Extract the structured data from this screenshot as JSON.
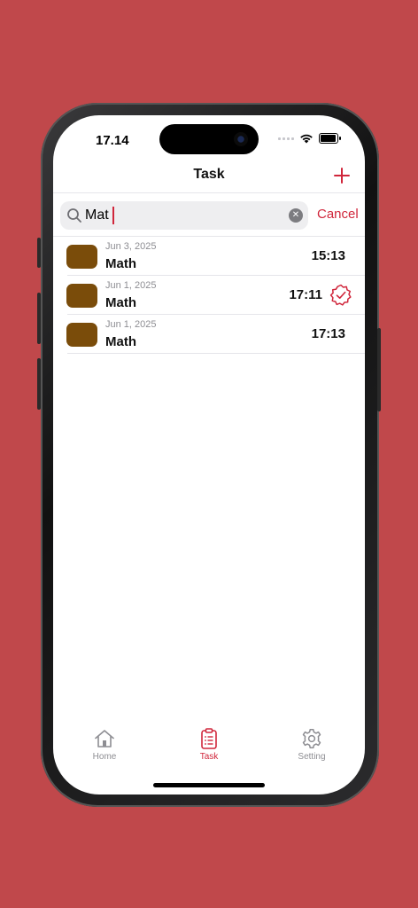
{
  "status": {
    "time": "17.14"
  },
  "nav": {
    "title": "Task"
  },
  "search": {
    "value": "Mat",
    "cancel_label": "Cancel"
  },
  "tasks": [
    {
      "date": "Jun 3, 2025",
      "name": "Math",
      "time": "15:13",
      "completed": false
    },
    {
      "date": "Jun 1, 2025",
      "name": "Math",
      "time": "17:11",
      "completed": true
    },
    {
      "date": "Jun 1, 2025",
      "name": "Math",
      "time": "17:13",
      "completed": false
    }
  ],
  "tabs": [
    {
      "label": "Home",
      "icon": "home-icon",
      "active": false
    },
    {
      "label": "Task",
      "icon": "clipboard-list-icon",
      "active": true
    },
    {
      "label": "Setting",
      "icon": "gear-icon",
      "active": false
    }
  ],
  "colors": {
    "accent": "#d0263b",
    "background": "#c0484b",
    "thumb": "#7a4c0a"
  }
}
